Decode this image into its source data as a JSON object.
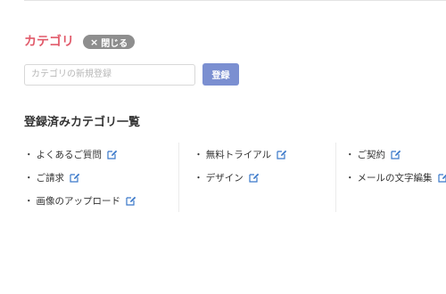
{
  "colors": {
    "title": "#e15a6a",
    "close_pill": "#8e8e8e",
    "register_button": "#7b8fd1",
    "edit_icon": "#3a78c9"
  },
  "header": {
    "title": "カテゴリ",
    "close_label": "閉じる",
    "close_icon": "×"
  },
  "add_form": {
    "placeholder": "カテゴリの新規登録",
    "value": "",
    "register_label": "登録"
  },
  "registered": {
    "title": "登録済みカテゴリ一覧",
    "bullet": "・",
    "columns": [
      {
        "items": [
          "よくあるご質問",
          "ご請求",
          "画像のアップロード"
        ]
      },
      {
        "items": [
          "無料トライアル",
          "デザイン"
        ]
      },
      {
        "items": [
          "ご契約",
          "メールの文字編集"
        ]
      }
    ],
    "edit_icon": "edit-icon"
  }
}
